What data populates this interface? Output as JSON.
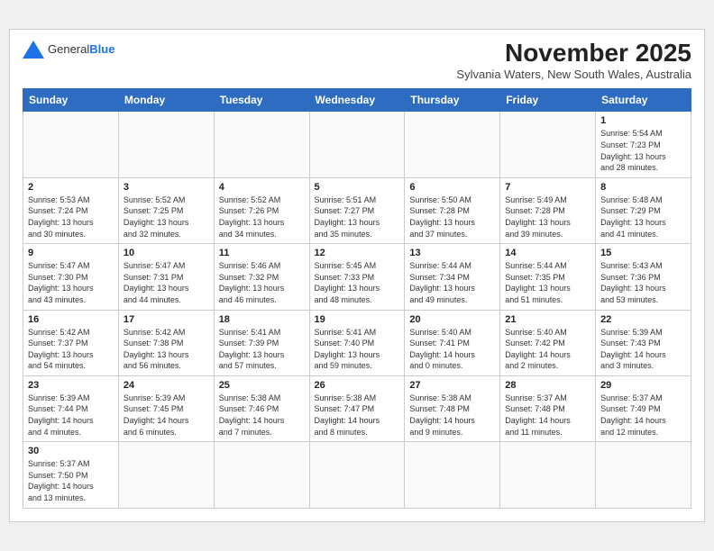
{
  "header": {
    "logo_line1": "General",
    "logo_line2": "Blue",
    "month_title": "November 2025",
    "subtitle": "Sylvania Waters, New South Wales, Australia"
  },
  "days_of_week": [
    "Sunday",
    "Monday",
    "Tuesday",
    "Wednesday",
    "Thursday",
    "Friday",
    "Saturday"
  ],
  "weeks": [
    [
      {
        "day": "",
        "info": ""
      },
      {
        "day": "",
        "info": ""
      },
      {
        "day": "",
        "info": ""
      },
      {
        "day": "",
        "info": ""
      },
      {
        "day": "",
        "info": ""
      },
      {
        "day": "",
        "info": ""
      },
      {
        "day": "1",
        "info": "Sunrise: 5:54 AM\nSunset: 7:23 PM\nDaylight: 13 hours\nand 28 minutes."
      }
    ],
    [
      {
        "day": "2",
        "info": "Sunrise: 5:53 AM\nSunset: 7:24 PM\nDaylight: 13 hours\nand 30 minutes."
      },
      {
        "day": "3",
        "info": "Sunrise: 5:52 AM\nSunset: 7:25 PM\nDaylight: 13 hours\nand 32 minutes."
      },
      {
        "day": "4",
        "info": "Sunrise: 5:52 AM\nSunset: 7:26 PM\nDaylight: 13 hours\nand 34 minutes."
      },
      {
        "day": "5",
        "info": "Sunrise: 5:51 AM\nSunset: 7:27 PM\nDaylight: 13 hours\nand 35 minutes."
      },
      {
        "day": "6",
        "info": "Sunrise: 5:50 AM\nSunset: 7:28 PM\nDaylight: 13 hours\nand 37 minutes."
      },
      {
        "day": "7",
        "info": "Sunrise: 5:49 AM\nSunset: 7:28 PM\nDaylight: 13 hours\nand 39 minutes."
      },
      {
        "day": "8",
        "info": "Sunrise: 5:48 AM\nSunset: 7:29 PM\nDaylight: 13 hours\nand 41 minutes."
      }
    ],
    [
      {
        "day": "9",
        "info": "Sunrise: 5:47 AM\nSunset: 7:30 PM\nDaylight: 13 hours\nand 43 minutes."
      },
      {
        "day": "10",
        "info": "Sunrise: 5:47 AM\nSunset: 7:31 PM\nDaylight: 13 hours\nand 44 minutes."
      },
      {
        "day": "11",
        "info": "Sunrise: 5:46 AM\nSunset: 7:32 PM\nDaylight: 13 hours\nand 46 minutes."
      },
      {
        "day": "12",
        "info": "Sunrise: 5:45 AM\nSunset: 7:33 PM\nDaylight: 13 hours\nand 48 minutes."
      },
      {
        "day": "13",
        "info": "Sunrise: 5:44 AM\nSunset: 7:34 PM\nDaylight: 13 hours\nand 49 minutes."
      },
      {
        "day": "14",
        "info": "Sunrise: 5:44 AM\nSunset: 7:35 PM\nDaylight: 13 hours\nand 51 minutes."
      },
      {
        "day": "15",
        "info": "Sunrise: 5:43 AM\nSunset: 7:36 PM\nDaylight: 13 hours\nand 53 minutes."
      }
    ],
    [
      {
        "day": "16",
        "info": "Sunrise: 5:42 AM\nSunset: 7:37 PM\nDaylight: 13 hours\nand 54 minutes."
      },
      {
        "day": "17",
        "info": "Sunrise: 5:42 AM\nSunset: 7:38 PM\nDaylight: 13 hours\nand 56 minutes."
      },
      {
        "day": "18",
        "info": "Sunrise: 5:41 AM\nSunset: 7:39 PM\nDaylight: 13 hours\nand 57 minutes."
      },
      {
        "day": "19",
        "info": "Sunrise: 5:41 AM\nSunset: 7:40 PM\nDaylight: 13 hours\nand 59 minutes."
      },
      {
        "day": "20",
        "info": "Sunrise: 5:40 AM\nSunset: 7:41 PM\nDaylight: 14 hours\nand 0 minutes."
      },
      {
        "day": "21",
        "info": "Sunrise: 5:40 AM\nSunset: 7:42 PM\nDaylight: 14 hours\nand 2 minutes."
      },
      {
        "day": "22",
        "info": "Sunrise: 5:39 AM\nSunset: 7:43 PM\nDaylight: 14 hours\nand 3 minutes."
      }
    ],
    [
      {
        "day": "23",
        "info": "Sunrise: 5:39 AM\nSunset: 7:44 PM\nDaylight: 14 hours\nand 4 minutes."
      },
      {
        "day": "24",
        "info": "Sunrise: 5:39 AM\nSunset: 7:45 PM\nDaylight: 14 hours\nand 6 minutes."
      },
      {
        "day": "25",
        "info": "Sunrise: 5:38 AM\nSunset: 7:46 PM\nDaylight: 14 hours\nand 7 minutes."
      },
      {
        "day": "26",
        "info": "Sunrise: 5:38 AM\nSunset: 7:47 PM\nDaylight: 14 hours\nand 8 minutes."
      },
      {
        "day": "27",
        "info": "Sunrise: 5:38 AM\nSunset: 7:48 PM\nDaylight: 14 hours\nand 9 minutes."
      },
      {
        "day": "28",
        "info": "Sunrise: 5:37 AM\nSunset: 7:48 PM\nDaylight: 14 hours\nand 11 minutes."
      },
      {
        "day": "29",
        "info": "Sunrise: 5:37 AM\nSunset: 7:49 PM\nDaylight: 14 hours\nand 12 minutes."
      }
    ],
    [
      {
        "day": "30",
        "info": "Sunrise: 5:37 AM\nSunset: 7:50 PM\nDaylight: 14 hours\nand 13 minutes."
      },
      {
        "day": "",
        "info": ""
      },
      {
        "day": "",
        "info": ""
      },
      {
        "day": "",
        "info": ""
      },
      {
        "day": "",
        "info": ""
      },
      {
        "day": "",
        "info": ""
      },
      {
        "day": "",
        "info": ""
      }
    ]
  ]
}
